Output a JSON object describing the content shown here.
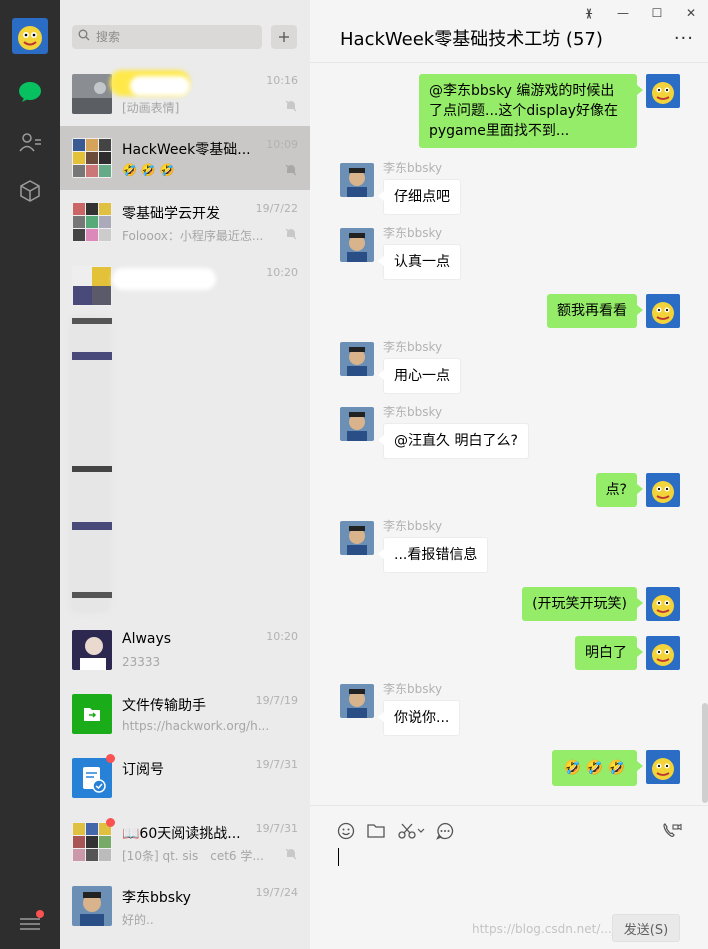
{
  "search": {
    "placeholder": "搜索"
  },
  "nav": {
    "icons": [
      "chat-icon",
      "contacts-icon",
      "cube-icon",
      "menu-icon"
    ]
  },
  "conversations": [
    {
      "name": "",
      "time": "10:16",
      "preview": "[动画表情]"
    },
    {
      "name": "HackWeek零基础...",
      "time": "10:09",
      "preview": "🤣 🤣 🤣"
    },
    {
      "name": "零基础学云开发",
      "time": "19/7/22",
      "preview": "Foloo​ox：小程序最近怎..."
    },
    {
      "name": "",
      "time": "10:20",
      "preview": ""
    },
    {
      "name": "Always",
      "time": "10:20",
      "preview": "23333"
    },
    {
      "name": "文件传输助手",
      "time": "19/7/19",
      "preview": "https://hackwork.org/h..."
    },
    {
      "name": "订阅号",
      "time": "19/7/31",
      "preview": ""
    },
    {
      "name": "📖60天阅读挑战...",
      "time": "19/7/31",
      "preview": "[10条] qt. sis　cet6 学..."
    },
    {
      "name": "李东bbsky",
      "time": "19/7/24",
      "preview": "好的.."
    }
  ],
  "chat": {
    "title": "HackWeek零基础技术工坊 (57)",
    "more": "···",
    "window_controls": [
      "ᚕ",
      "—",
      "☐",
      "✕"
    ],
    "messages": [
      {
        "dir": "out",
        "text": "@李东bbsky 编游戏的时候出了点问题...这个display好像在pygame里面找不到..."
      },
      {
        "dir": "in",
        "sender": "李东bbsky",
        "text": "仔细点吧"
      },
      {
        "dir": "in",
        "sender": "李东bbsky",
        "text": "认真一点"
      },
      {
        "dir": "out",
        "text": "额我再看看"
      },
      {
        "dir": "in",
        "sender": "李东bbsky",
        "text": "用心一点"
      },
      {
        "dir": "in",
        "sender": "李东bbsky",
        "text": "@汪直久 明白了么?"
      },
      {
        "dir": "out",
        "text": "点?"
      },
      {
        "dir": "in",
        "sender": "李东bbsky",
        "text": "...看报错信息"
      },
      {
        "dir": "out",
        "text": "(开玩笑开玩笑)"
      },
      {
        "dir": "out",
        "text": "明白了"
      },
      {
        "dir": "in",
        "sender": "李东bbsky",
        "text": "你说你..."
      },
      {
        "dir": "out",
        "text": "🤣 🤣 🤣"
      }
    ],
    "send_label": "发送(S)",
    "watermark": "https://blog.csdn.net/..._wang"
  }
}
